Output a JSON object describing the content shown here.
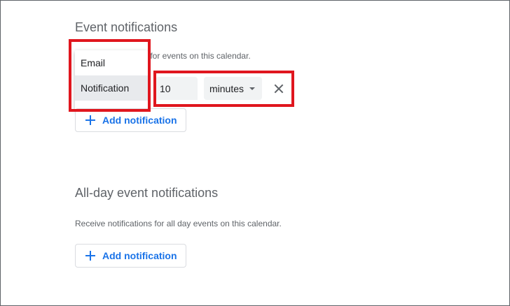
{
  "event_notifications": {
    "title": "Event notifications",
    "description_partial": "s for events on this calendar.",
    "menu": {
      "items": [
        {
          "label": "Email"
        },
        {
          "label": "Notification"
        }
      ]
    },
    "amount_value": "10",
    "unit": "minutes",
    "add_label": "Add notification"
  },
  "allday_notifications": {
    "title": "All-day event notifications",
    "description": "Receive notifications for all day events on this calendar.",
    "add_label": "Add notification"
  },
  "icons": {
    "plus": "plus-icon",
    "close": "close-icon",
    "dropdown": "caret-down-icon"
  },
  "colors": {
    "accent": "#1a73e8",
    "highlight": "#e0161e",
    "selected_menu_bg": "#e8eaed",
    "field_bg": "#f1f3f4"
  }
}
